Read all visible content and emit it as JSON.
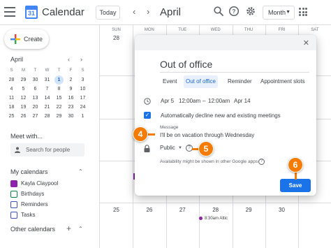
{
  "app": {
    "title": "Calendar",
    "logo_day": "31"
  },
  "header": {
    "today_label": "Today",
    "prev_icon": "chevron-left",
    "next_icon": "chevron-right",
    "month_title": "April",
    "view_label": "Month",
    "icons": [
      "search-icon",
      "help-icon",
      "settings-icon",
      "apps-icon"
    ]
  },
  "sidebar": {
    "create_label": "Create",
    "mini_cal": {
      "title": "April",
      "day_heads": [
        "S",
        "M",
        "T",
        "W",
        "T",
        "F",
        "S"
      ],
      "days": [
        "28",
        "29",
        "30",
        "31",
        "1",
        "2",
        "3",
        "4",
        "5",
        "6",
        "7",
        "8",
        "9",
        "10",
        "11",
        "12",
        "13",
        "14",
        "15",
        "16",
        "17",
        "18",
        "19",
        "20",
        "21",
        "22",
        "23",
        "24",
        "25",
        "26",
        "27",
        "28",
        "29",
        "30",
        "1"
      ],
      "current": "1"
    },
    "meet_with_label": "Meet with...",
    "search_people_placeholder": "Search for people",
    "my_calendars_label": "My calendars",
    "calendars": [
      {
        "name": "Kayla Claypool",
        "color": "#8e24aa",
        "checked": true
      },
      {
        "name": "Birthdays",
        "color": "#0b8043",
        "checked": false
      },
      {
        "name": "Reminders",
        "color": "#3f51b5",
        "checked": false
      },
      {
        "name": "Tasks",
        "color": "#3f51b5",
        "checked": false
      }
    ],
    "other_calendars_label": "Other calendars"
  },
  "grid": {
    "day_heads": [
      "SUN",
      "MON",
      "TUE",
      "WED",
      "THU",
      "FRI",
      "SAT"
    ],
    "first_row": [
      "28",
      "",
      "",
      "",
      "",
      "",
      ""
    ],
    "last_row": [
      "25",
      "26",
      "27",
      "28",
      "29",
      "30",
      ""
    ],
    "event": {
      "time": "8:30am",
      "title": "Attic"
    }
  },
  "dialog": {
    "title": "Out of office",
    "tabs": [
      "Event",
      "Out of office",
      "Reminder",
      "Appointment slots"
    ],
    "active_tab": "Out of office",
    "start_date": "Apr 5",
    "start_time": "12:00am",
    "dash": "–",
    "end_time": "12:00am",
    "end_date": "Apr 14",
    "auto_decline_label": "Automatically decline new and existing meetings",
    "message_label": "Message",
    "message_value": "I'll be on vacation through Wednesday",
    "visibility_value": "Public",
    "availability_note": "Availability might be shown in other Google apps",
    "save_label": "Save",
    "close_icon": "close-icon"
  },
  "steps": [
    "4",
    "5",
    "6"
  ],
  "colors": {
    "accent": "#1a73e8",
    "badge": "#f57c00",
    "active_tab_bg": "#e8f0fe"
  }
}
